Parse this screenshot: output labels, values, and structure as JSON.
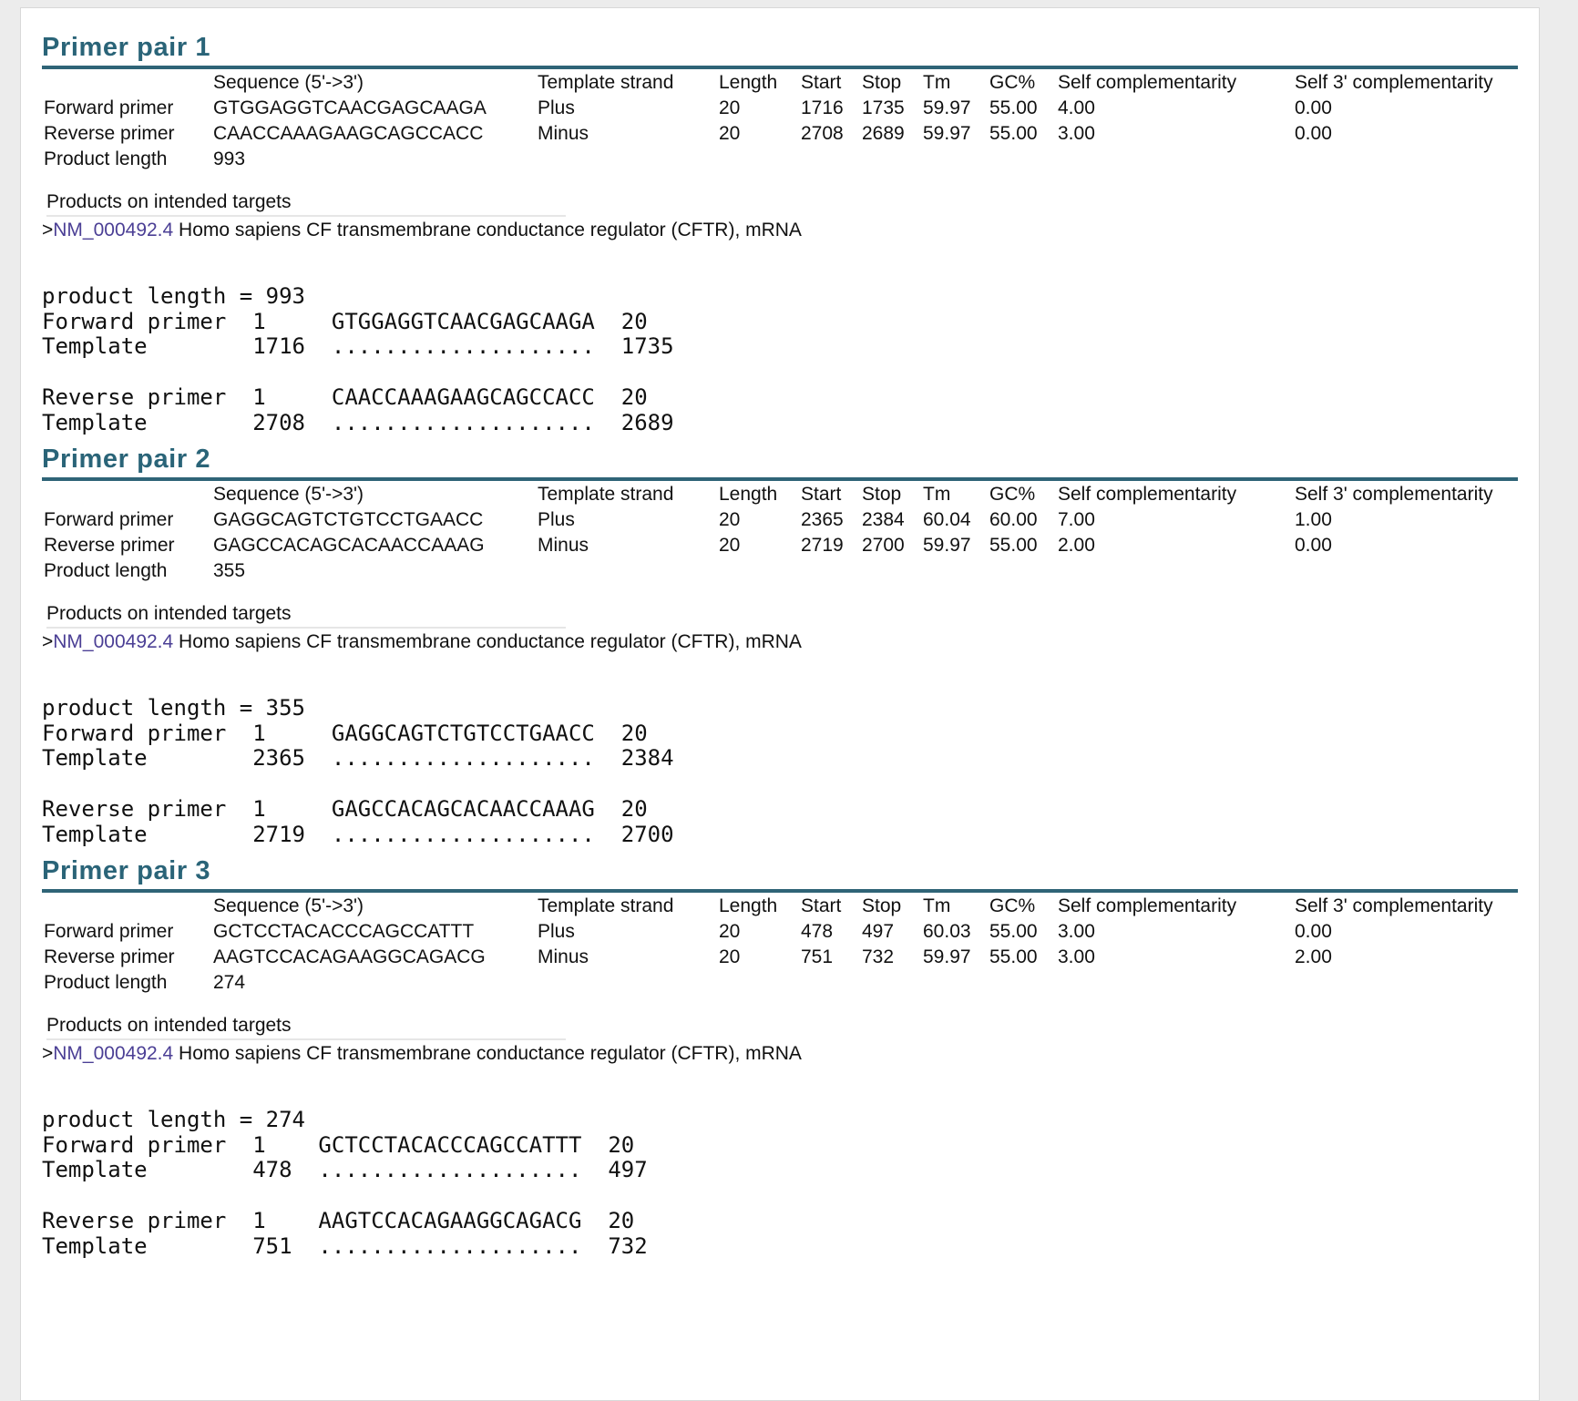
{
  "headers": {
    "sequence": "Sequence (5'->3')",
    "strand": "Template strand",
    "length": "Length",
    "start": "Start",
    "stop": "Stop",
    "tm": "Tm",
    "gc": "GC%",
    "self_comp": "Self complementarity",
    "self3_comp": "Self 3' complementarity"
  },
  "labels": {
    "forward": "Forward primer",
    "reverse": "Reverse primer",
    "product_length": "Product length",
    "products_on_targets": "Products on intended targets",
    "target_prefix": ">",
    "target_accession": "NM_000492.4",
    "target_description": " Homo sapiens CF transmembrane conductance regulator (CFTR), mRNA"
  },
  "pairs": [
    {
      "title": "Primer pair 1",
      "forward": {
        "sequence": "GTGGAGGTCAACGAGCAAGA",
        "strand": "Plus",
        "length": "20",
        "start": "1716",
        "stop": "1735",
        "tm": "59.97",
        "gc": "55.00",
        "self_comp": "4.00",
        "self3_comp": "0.00"
      },
      "reverse": {
        "sequence": "CAACCAAAGAAGCAGCCACC",
        "strand": "Minus",
        "length": "20",
        "start": "2708",
        "stop": "2689",
        "tm": "59.97",
        "gc": "55.00",
        "self_comp": "3.00",
        "self3_comp": "0.00"
      },
      "product_length": "993",
      "alignment": "product length = 993\nForward primer  1     GTGGAGGTCAACGAGCAAGA  20\nTemplate        1716  ....................  1735\n\nReverse primer  1     CAACCAAAGAAGCAGCCACC  20\nTemplate        2708  ....................  2689"
    },
    {
      "title": "Primer pair 2",
      "forward": {
        "sequence": "GAGGCAGTCTGTCCTGAACC",
        "strand": "Plus",
        "length": "20",
        "start": "2365",
        "stop": "2384",
        "tm": "60.04",
        "gc": "60.00",
        "self_comp": "7.00",
        "self3_comp": "1.00"
      },
      "reverse": {
        "sequence": "GAGCCACAGCACAACCAAAG",
        "strand": "Minus",
        "length": "20",
        "start": "2719",
        "stop": "2700",
        "tm": "59.97",
        "gc": "55.00",
        "self_comp": "2.00",
        "self3_comp": "0.00"
      },
      "product_length": "355",
      "alignment": "product length = 355\nForward primer  1     GAGGCAGTCTGTCCTGAACC  20\nTemplate        2365  ....................  2384\n\nReverse primer  1     GAGCCACAGCACAACCAAAG  20\nTemplate        2719  ....................  2700"
    },
    {
      "title": "Primer pair 3",
      "forward": {
        "sequence": "GCTCCTACACCCAGCCATTT",
        "strand": "Plus",
        "length": "20",
        "start": "478",
        "stop": "497",
        "tm": "60.03",
        "gc": "55.00",
        "self_comp": "3.00",
        "self3_comp": "0.00"
      },
      "reverse": {
        "sequence": "AAGTCCACAGAAGGCAGACG",
        "strand": "Minus",
        "length": "20",
        "start": "751",
        "stop": "732",
        "tm": "59.97",
        "gc": "55.00",
        "self_comp": "3.00",
        "self3_comp": "2.00"
      },
      "product_length": "274",
      "alignment": "product length = 274\nForward primer  1    GCTCCTACACCCAGCCATTT  20\nTemplate        478  ....................  497\n\nReverse primer  1    AAGTCCACAGAAGGCAGACG  20\nTemplate        751  ....................  732"
    }
  ]
}
